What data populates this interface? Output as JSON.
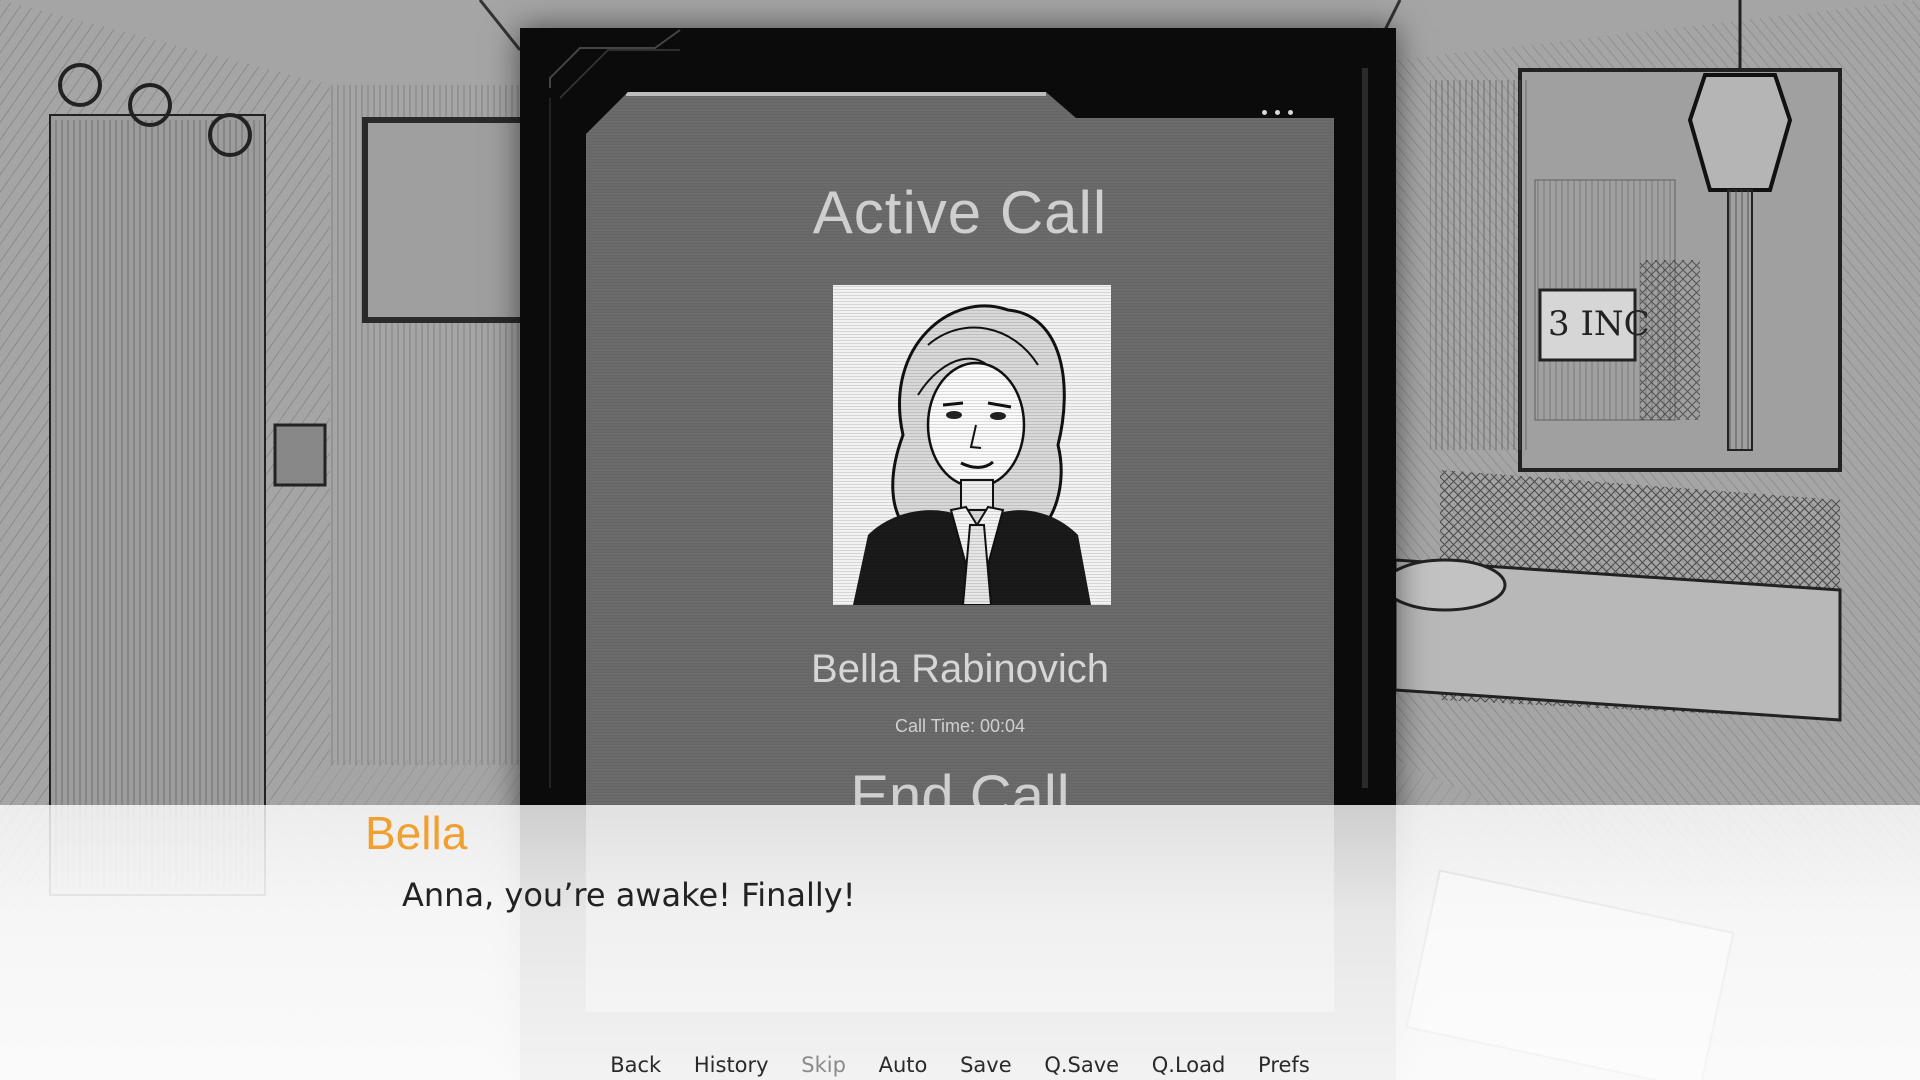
{
  "call": {
    "title": "Active Call",
    "caller_name": "Bella Rabinovich",
    "call_time": "Call Time: 00:04",
    "end_call_label": "End Call"
  },
  "dialogue": {
    "speaker": "Bella",
    "text": "Anna, you’re awake! Finally!"
  },
  "quick_menu": {
    "back": "Back",
    "history": "History",
    "skip": "Skip",
    "auto": "Auto",
    "save": "Save",
    "qsave": "Q.Save",
    "qload": "Q.Load",
    "prefs": "Prefs"
  },
  "colors": {
    "speaker": "#f0a030",
    "phone_screen": "#6b6b6b",
    "phone_frame": "#0b0b0b"
  }
}
